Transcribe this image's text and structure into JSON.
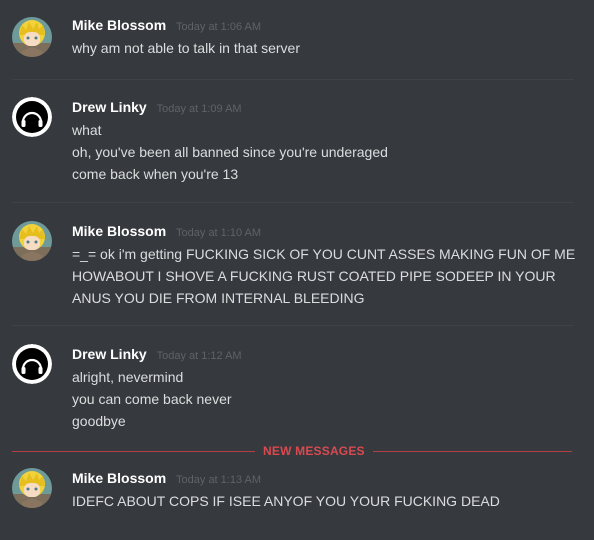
{
  "messages": [
    {
      "author": "Mike Blossom",
      "timestamp": "Today at 1:06 AM",
      "avatar": "anime-avatar-icon",
      "lines": [
        "why am not able to talk in that server"
      ]
    },
    {
      "author": "Drew Linky",
      "timestamp": "Today at 1:09 AM",
      "avatar": "headphones-avatar-icon",
      "lines": [
        "what",
        "oh, you've been all banned since you're underaged",
        "come back when you're 13"
      ]
    },
    {
      "author": "Mike Blossom",
      "timestamp": "Today at 1:10 AM",
      "avatar": "anime-avatar-icon",
      "lines": [
        "=_= ok i'm getting FUCKING SICK OF YOU CUNT ASSES MAKING FUN OF ME",
        "HOWABOUT I SHOVE A FUCKING RUST COATED PIPE SODEEP IN YOUR",
        "ANUS YOU DIE FROM INTERNAL BLEEDING"
      ]
    },
    {
      "author": "Drew Linky",
      "timestamp": "Today at 1:12 AM",
      "avatar": "headphones-avatar-icon",
      "lines": [
        "alright, nevermind",
        "you can come back never",
        "goodbye"
      ]
    },
    {
      "author": "Mike Blossom",
      "timestamp": "Today at 1:13 AM",
      "avatar": "anime-avatar-icon",
      "lines": [
        "IDEFC ABOUT COPS IF ISEE ANYOF YOU YOUR FUCKING DEAD"
      ]
    }
  ],
  "new_messages_label": "NEW MESSAGES",
  "colors": {
    "background": "#36393e",
    "username": "#ffffff",
    "text": "#dcddde",
    "timestamp": "#5f6266",
    "new_messages": "#d94a50"
  }
}
